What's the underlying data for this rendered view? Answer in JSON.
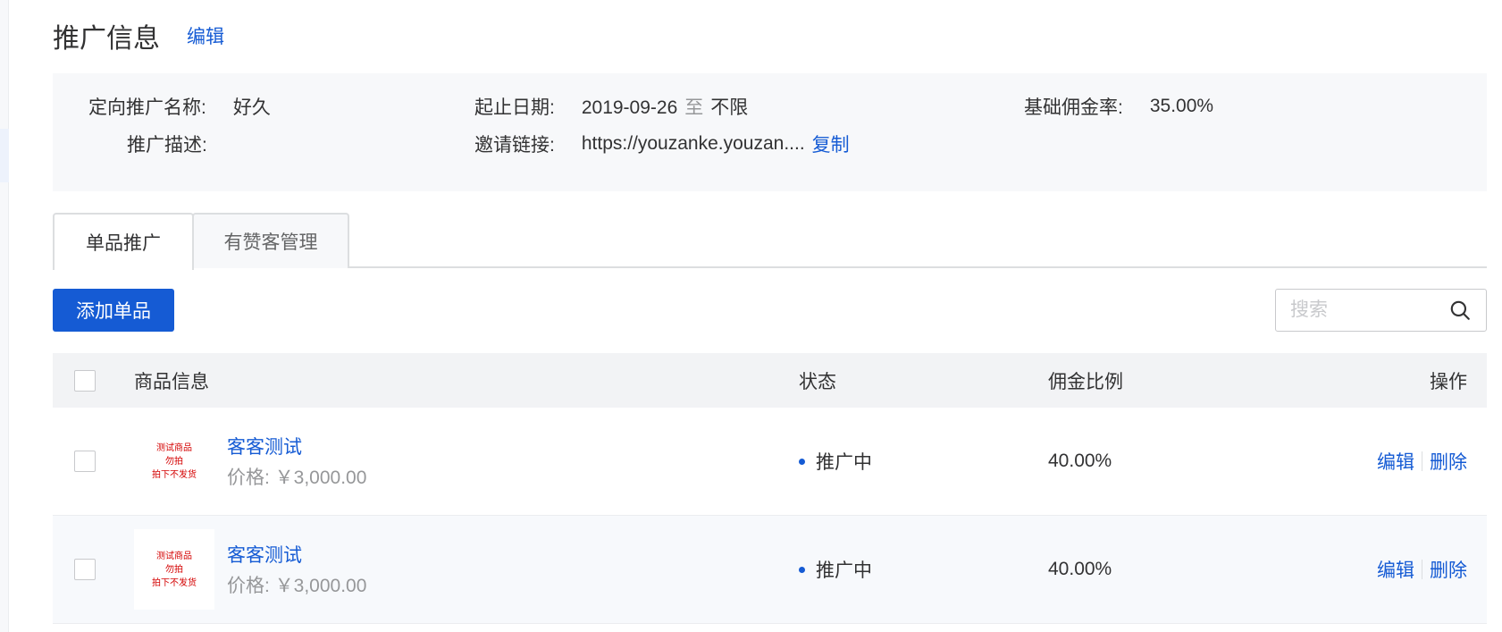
{
  "header": {
    "title": "推广信息",
    "edit_label": "编辑"
  },
  "info": {
    "name_label": "定向推广名称:",
    "name_value": "好久",
    "date_label": "起止日期:",
    "date_start": "2019-09-26",
    "date_to": "至",
    "date_end": "不限",
    "rate_label": "基础佣金率:",
    "rate_value": "35.00%",
    "desc_label": "推广描述:",
    "link_label": "邀请链接:",
    "link_value": "https://youzanke.youzan....",
    "copy_label": "复制"
  },
  "tabs": [
    {
      "label": "单品推广",
      "active": true
    },
    {
      "label": "有赞客管理",
      "active": false
    }
  ],
  "toolbar": {
    "add_label": "添加单品",
    "search_placeholder": "搜索"
  },
  "table": {
    "columns": {
      "goods": "商品信息",
      "status": "状态",
      "commission": "佣金比例",
      "actions": "操作"
    },
    "rows": [
      {
        "thumb_lines": [
          "测试商品",
          "勿拍",
          "拍下不发货"
        ],
        "name": "客客测试",
        "price": "价格: ￥3,000.00",
        "status": "推广中",
        "commission": "40.00%",
        "edit_label": "编辑",
        "delete_label": "删除"
      },
      {
        "thumb_lines": [
          "测试商品",
          "勿拍",
          "拍下不发货"
        ],
        "name": "客客测试",
        "price": "价格: ￥3,000.00",
        "status": "推广中",
        "commission": "40.00%",
        "edit_label": "编辑",
        "delete_label": "删除"
      }
    ]
  },
  "colors": {
    "primary": "#155bd4",
    "thumb_text": "#d40000"
  },
  "icons": {
    "search": "search-icon"
  }
}
